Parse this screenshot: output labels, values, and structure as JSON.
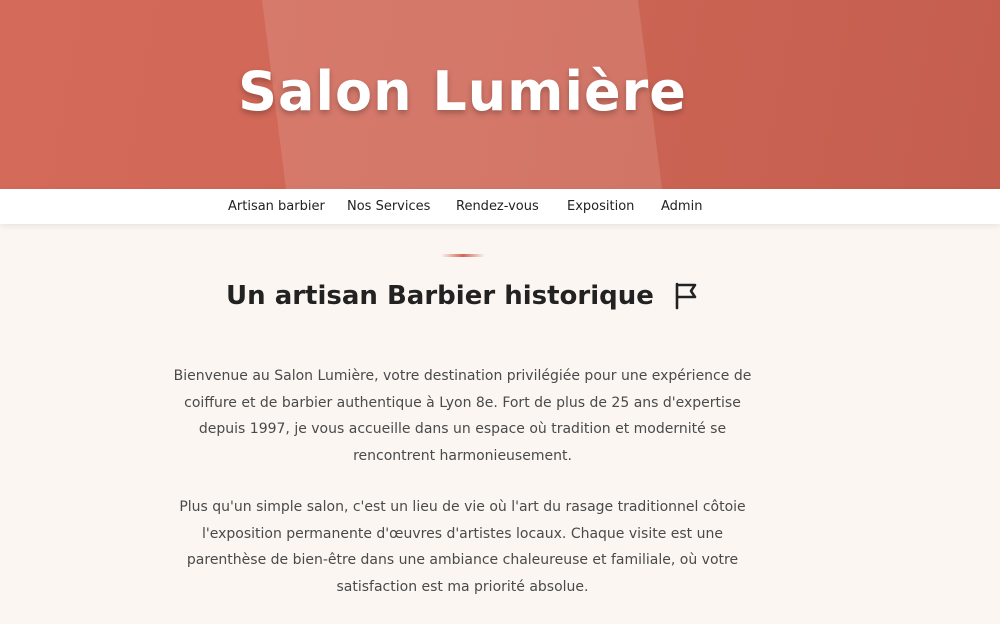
{
  "hero": {
    "title": "Salon Lumière"
  },
  "nav": {
    "items": [
      {
        "label": "Artisan barbier"
      },
      {
        "label": "Nos Services"
      },
      {
        "label": "Rendez-vous"
      },
      {
        "label": "Exposition"
      },
      {
        "label": "Admin"
      }
    ]
  },
  "main": {
    "heading": "Un artisan Barbier historique",
    "heading_icon": "flag-icon",
    "paragraphs": [
      "Bienvenue au Salon Lumière, votre destination privilégiée pour une expérience de coiffure et de barbier authentique à Lyon 8e. Fort de plus de 25 ans d'expertise depuis 1997, je vous accueille dans un espace où tradition et modernité se rencontrent harmonieusement.",
      "Plus qu'un simple salon, c'est un lieu de vie où l'art du rasage traditionnel côtoie l'exposition permanente d'œuvres d'artistes locaux. Chaque visite est une parenthèse de bien-être dans une ambiance chaleureuse et familiale, où votre satisfaction est ma priorité absolue."
    ]
  },
  "colors": {
    "hero_background": "#cf6656",
    "page_background": "#fbf6f2",
    "text": "#222222",
    "body_text": "#4a4a4a"
  }
}
